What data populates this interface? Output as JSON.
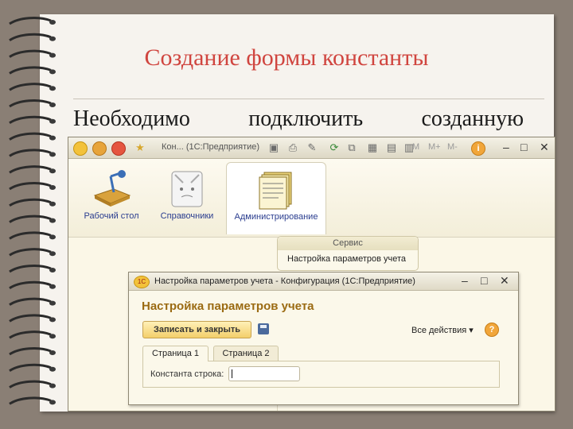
{
  "slide": {
    "title": "Создание формы константы",
    "body_words": [
      "Необходимо",
      "подключить",
      "созданную"
    ]
  },
  "main_window": {
    "title": "Кон... (1С:Предприятие)",
    "toolbar_m": [
      "M",
      "M+",
      "M-"
    ],
    "sections": [
      {
        "label": "Рабочий стол",
        "icon": "desk-lamp-icon"
      },
      {
        "label": "Справочники",
        "icon": "books-icon"
      },
      {
        "label": "Администрирование",
        "icon": "folders-icon"
      }
    ],
    "service_panel": {
      "header": "Сервис",
      "link": "Настройка параметров учета"
    }
  },
  "dialog": {
    "title": "Настройка параметров учета - Конфигурация (1С:Предприятие)",
    "logo": "1С",
    "heading": "Настройка параметров учета",
    "save_button": "Записать и закрыть",
    "all_actions": "Все действия ▾",
    "help": "?",
    "tabs": [
      "Страница 1",
      "Страница 2"
    ],
    "field_label": "Константа строка:",
    "field_value": ""
  },
  "colors": {
    "title_red": "#d0453f",
    "heading_brown": "#9b6b13",
    "section_blue": "#2a3d8f",
    "button_yellow": "#f3cf6a"
  }
}
